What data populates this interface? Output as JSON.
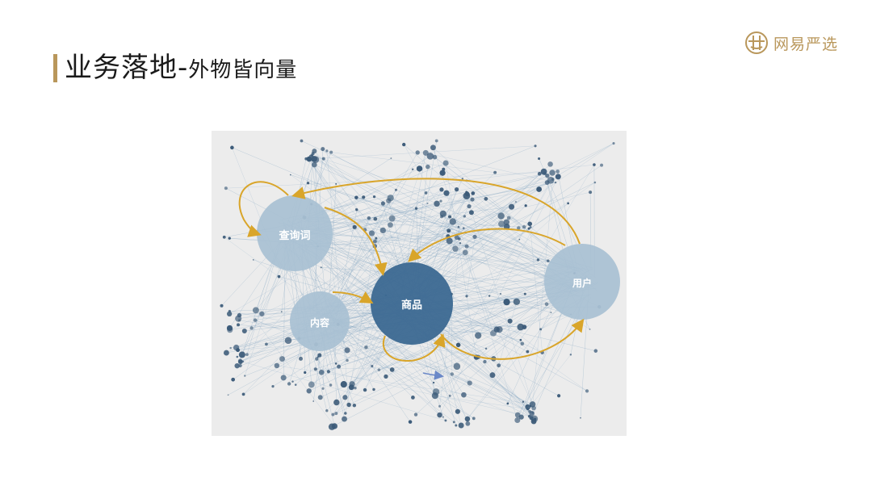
{
  "slide": {
    "title_main": "业务落地-",
    "title_sub": "外物皆向量"
  },
  "brand": {
    "name": "网易严选",
    "mark_icon": "yanxuan-logo-icon",
    "color": "#b9975b"
  },
  "graph": {
    "background": "#ececec",
    "edge_color": "#d9a52a",
    "node_color": "#3b5a78",
    "hubs": [
      {
        "id": "query",
        "label": "查询词",
        "color": "#a8c0d2"
      },
      {
        "id": "product",
        "label": "商品",
        "color": "#3d6a93"
      },
      {
        "id": "content",
        "label": "内容",
        "color": "#a8c0d2"
      },
      {
        "id": "user",
        "label": "用户",
        "color": "#a8c0d2"
      }
    ]
  }
}
